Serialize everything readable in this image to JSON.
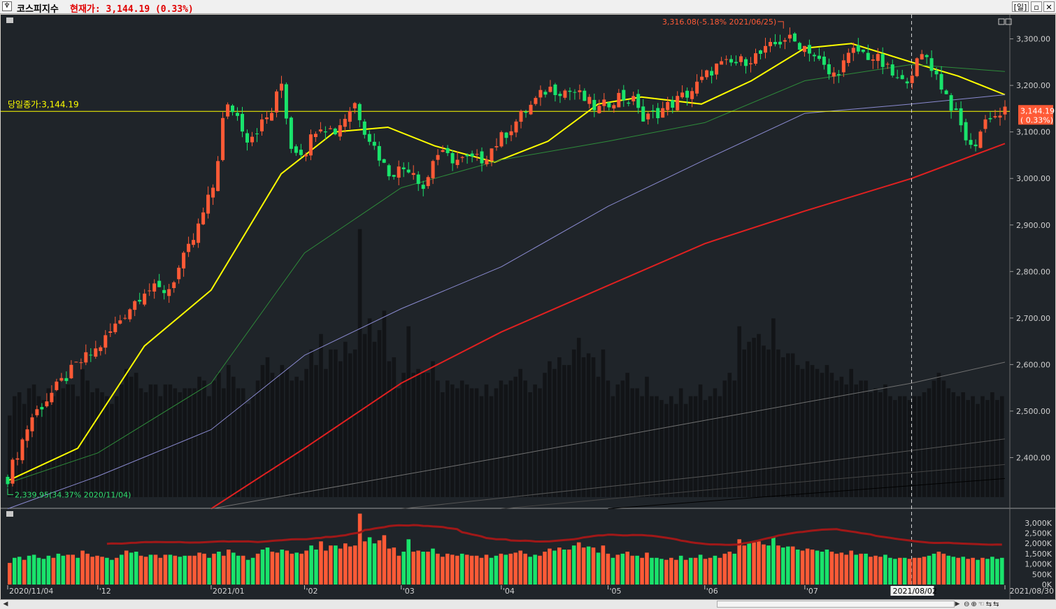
{
  "window": {
    "title": "코스피지수",
    "price_text": "현재가: 3,144.19  (0.33%)",
    "period_button": "[일]",
    "restore_icon": "restore-icon",
    "close_icon": "close-icon"
  },
  "chart_data": [
    {
      "type": "candlestick",
      "instrument": "코스피지수",
      "y_ticks": [
        "3,300.00",
        "3,200.00",
        "3,100.00",
        "3,000.00",
        "2,900.00",
        "2,800.00",
        "2,700.00",
        "2,600.00",
        "2,500.00",
        "2,400.00"
      ],
      "y_tick_values": [
        3300,
        3200,
        3100,
        3000,
        2900,
        2800,
        2700,
        2600,
        2500,
        2400
      ],
      "ylim": [
        2315,
        3340
      ],
      "x_labels": [
        "2020/11/04",
        "'12",
        "2021/01",
        "'02",
        "'03",
        "'04",
        "'05",
        "'06",
        "'07",
        "2021/08/02",
        "2021/08/30"
      ],
      "x_label_dates": [
        "2020-11-04",
        "2020-12-01",
        "2021-01-04",
        "2021-02-01",
        "2021-03-02",
        "2021-04-01",
        "2021-05-03",
        "2021-06-01",
        "2021-07-01",
        "2021-08-02",
        "2021-08-30"
      ],
      "date_start": "2020-11-04",
      "date_end": "2021-08-30",
      "close_line": {
        "label": "당일종가:3,144.19",
        "value": 3144.19,
        "color": "#ffff00"
      },
      "price_tag": {
        "value": "3,144.19",
        "change": "( 0.33%)",
        "color": "#ff5a36"
      },
      "max_annotation": {
        "text": "3,316.08(-5.18% 2021/06/25)",
        "value": 3316.08,
        "date": "2021-06-25",
        "color": "#ff5a36"
      },
      "min_annotation": {
        "text": "2,339.95(34.37% 2020/11/04)",
        "value": 2339.95,
        "date": "2020-11-04",
        "color": "#30e070"
      },
      "crosshair_date": "2021-08-02",
      "up_color": "#ff5a36",
      "down_color": "#19e36b",
      "close_points": [
        [
          "2020-11-04",
          2357
        ],
        [
          "2020-11-11",
          2485
        ],
        [
          "2020-11-18",
          2545
        ],
        [
          "2020-11-25",
          2601
        ],
        [
          "2020-12-01",
          2634
        ],
        [
          "2020-12-08",
          2700
        ],
        [
          "2020-12-15",
          2762
        ],
        [
          "2020-12-22",
          2759
        ],
        [
          "2020-12-30",
          2873
        ],
        [
          "2021-01-05",
          2990
        ],
        [
          "2021-01-08",
          3152
        ],
        [
          "2021-01-11",
          3148
        ],
        [
          "2021-01-15",
          3085
        ],
        [
          "2021-01-22",
          3140
        ],
        [
          "2021-01-25",
          3208
        ],
        [
          "2021-01-28",
          3069
        ],
        [
          "2021-02-01",
          3056
        ],
        [
          "2021-02-05",
          3120
        ],
        [
          "2021-02-10",
          3100
        ],
        [
          "2021-02-16",
          3163
        ],
        [
          "2021-02-19",
          3107
        ],
        [
          "2021-02-26",
          3013
        ],
        [
          "2021-03-05",
          3026
        ],
        [
          "2021-03-09",
          2976
        ],
        [
          "2021-03-12",
          3054
        ],
        [
          "2021-03-19",
          3039
        ],
        [
          "2021-03-26",
          3041
        ],
        [
          "2021-04-01",
          3087
        ],
        [
          "2021-04-08",
          3143
        ],
        [
          "2021-04-15",
          3194
        ],
        [
          "2021-04-23",
          3186
        ],
        [
          "2021-04-30",
          3147
        ],
        [
          "2021-05-06",
          3178
        ],
        [
          "2021-05-12",
          3161
        ],
        [
          "2021-05-13",
          3122
        ],
        [
          "2021-05-21",
          3156
        ],
        [
          "2021-05-28",
          3188
        ],
        [
          "2021-06-04",
          3240
        ],
        [
          "2021-06-11",
          3249
        ],
        [
          "2021-06-18",
          3268
        ],
        [
          "2021-06-25",
          3302
        ],
        [
          "2021-07-02",
          3281
        ],
        [
          "2021-07-09",
          3217
        ],
        [
          "2021-07-16",
          3276
        ],
        [
          "2021-07-23",
          3254
        ],
        [
          "2021-07-30",
          3202
        ],
        [
          "2021-08-06",
          3270
        ],
        [
          "2021-08-13",
          3171
        ],
        [
          "2021-08-20",
          3060
        ],
        [
          "2021-08-25",
          3138
        ],
        [
          "2021-08-27",
          3133
        ],
        [
          "2021-08-30",
          3144
        ]
      ],
      "moving_averages": [
        {
          "color": "#ffff00",
          "points": [
            [
              "2020-11-04",
              2350
            ],
            [
              "2020-11-25",
              2420
            ],
            [
              "2020-12-15",
              2640
            ],
            [
              "2021-01-04",
              2760
            ],
            [
              "2021-01-25",
              3010
            ],
            [
              "2021-02-10",
              3100
            ],
            [
              "2021-02-26",
              3110
            ],
            [
              "2021-03-12",
              3070
            ],
            [
              "2021-03-30",
              3035
            ],
            [
              "2021-04-15",
              3080
            ],
            [
              "2021-04-30",
              3160
            ],
            [
              "2021-05-13",
              3175
            ],
            [
              "2021-05-31",
              3160
            ],
            [
              "2021-06-15",
              3210
            ],
            [
              "2021-07-01",
              3280
            ],
            [
              "2021-07-15",
              3290
            ],
            [
              "2021-08-02",
              3250
            ],
            [
              "2021-08-16",
              3220
            ],
            [
              "2021-08-30",
              3180
            ]
          ]
        },
        {
          "color": "#2e8b3a",
          "points": [
            [
              "2020-11-04",
              2345
            ],
            [
              "2020-12-01",
              2410
            ],
            [
              "2021-01-04",
              2560
            ],
            [
              "2021-02-01",
              2840
            ],
            [
              "2021-03-02",
              2980
            ],
            [
              "2021-04-01",
              3040
            ],
            [
              "2021-05-03",
              3080
            ],
            [
              "2021-06-01",
              3120
            ],
            [
              "2021-07-01",
              3210
            ],
            [
              "2021-08-02",
              3245
            ],
            [
              "2021-08-30",
              3230
            ]
          ]
        },
        {
          "color": "#8a8ad0",
          "points": [
            [
              "2020-11-04",
              2290
            ],
            [
              "2020-12-01",
              2360
            ],
            [
              "2021-01-04",
              2460
            ],
            [
              "2021-02-01",
              2620
            ],
            [
              "2021-03-02",
              2720
            ],
            [
              "2021-04-01",
              2810
            ],
            [
              "2021-05-03",
              2940
            ],
            [
              "2021-06-01",
              3040
            ],
            [
              "2021-07-01",
              3140
            ],
            [
              "2021-08-02",
              3160
            ],
            [
              "2021-08-30",
              3180
            ]
          ]
        },
        {
          "color": "#e02020",
          "points": [
            [
              "2021-01-04",
              2290
            ],
            [
              "2021-02-01",
              2420
            ],
            [
              "2021-03-02",
              2560
            ],
            [
              "2021-04-01",
              2670
            ],
            [
              "2021-05-03",
              2770
            ],
            [
              "2021-06-01",
              2860
            ],
            [
              "2021-07-01",
              2930
            ],
            [
              "2021-08-02",
              3000
            ],
            [
              "2021-08-30",
              3075
            ]
          ]
        },
        {
          "color": "#707070",
          "points": [
            [
              "2021-01-04",
              2290
            ],
            [
              "2021-04-01",
              2400
            ],
            [
              "2021-06-01",
              2480
            ],
            [
              "2021-08-02",
              2560
            ],
            [
              "2021-08-30",
              2605
            ]
          ]
        },
        {
          "color": "#555555",
          "points": [
            [
              "2021-03-02",
              2290
            ],
            [
              "2021-06-01",
              2360
            ],
            [
              "2021-08-30",
              2440
            ]
          ]
        },
        {
          "color": "#444444",
          "points": [
            [
              "2021-04-01",
              2290
            ],
            [
              "2021-06-01",
              2330
            ],
            [
              "2021-08-30",
              2385
            ]
          ]
        },
        {
          "color": "#000000",
          "points": [
            [
              "2021-05-03",
              2290
            ],
            [
              "2021-08-30",
              2355
            ]
          ]
        }
      ]
    },
    {
      "type": "bar",
      "panel": "volume",
      "y_ticks": [
        "3,000K",
        "2,500K",
        "2,000K",
        "1,500K",
        "1,000K",
        "500K",
        "0K"
      ],
      "y_tick_values": [
        3000,
        2500,
        2000,
        1500,
        1000,
        500,
        0
      ],
      "ylim": [
        0,
        3300
      ],
      "average_line_color": "#a01818",
      "up_color": "#ff5a36",
      "down_color": "#19e36b",
      "values": [
        1050,
        1300,
        1350,
        1200,
        1400,
        1450,
        1300,
        1250,
        1400,
        1300,
        1500,
        1400,
        1450,
        1450,
        1300,
        1650,
        1500,
        1350,
        1400,
        1350,
        1300,
        1200,
        1300,
        1450,
        1650,
        1550,
        1600,
        1400,
        1350,
        1450,
        1450,
        1300,
        1450,
        1450,
        1400,
        1350,
        1400,
        1400,
        1400,
        1550,
        1500,
        1300,
        1500,
        1600,
        1400,
        1700,
        1550,
        1400,
        1400,
        1200,
        1300,
        1500,
        1700,
        1800,
        1600,
        1550,
        1700,
        1650,
        1500,
        1550,
        1500,
        1650,
        1900,
        1700,
        2100,
        1650,
        1900,
        1900,
        1750,
        2000,
        1850,
        1900,
        3450,
        2100,
        2300,
        2000,
        2150,
        2400,
        1750,
        1800,
        1400,
        1600,
        2200,
        1600,
        1650,
        1600,
        1600,
        1750,
        1500,
        1350,
        1500,
        1450,
        1400,
        1500,
        1450,
        1400,
        1400,
        1300,
        1450,
        1300,
        1400,
        1500,
        1450,
        1500,
        1550,
        1650,
        1500,
        1350,
        1450,
        1400,
        1600,
        1750,
        1650,
        1800,
        1700,
        1700,
        1900,
        2050,
        1800,
        1850,
        1800,
        1550,
        1900,
        1500,
        1300,
        1450,
        1500,
        1600,
        1400,
        1400,
        1300,
        1550,
        1300,
        1300,
        1250,
        1200,
        1300,
        1200,
        1400,
        1200,
        1300,
        1300,
        1450,
        1250,
        1300,
        1400,
        1300,
        1500,
        1600,
        1500,
        2200,
        1900,
        2000,
        2050,
        2100,
        1950,
        1900,
        2300,
        1900,
        1800,
        1850,
        1850,
        1700,
        1650,
        1750,
        1700,
        1650,
        1600,
        1700,
        1600,
        1500,
        1550,
        1450,
        1650,
        1450,
        1500,
        1500,
        1350,
        1400,
        1350,
        1450,
        1300,
        1250,
        1300,
        1300,
        1250,
        1300,
        1300,
        1350,
        1400,
        1500,
        1600,
        1500,
        1400,
        1350,
        1300,
        1350,
        1250,
        1300,
        1200,
        1300,
        1250,
        1350,
        1250,
        1300
      ]
    }
  ]
}
